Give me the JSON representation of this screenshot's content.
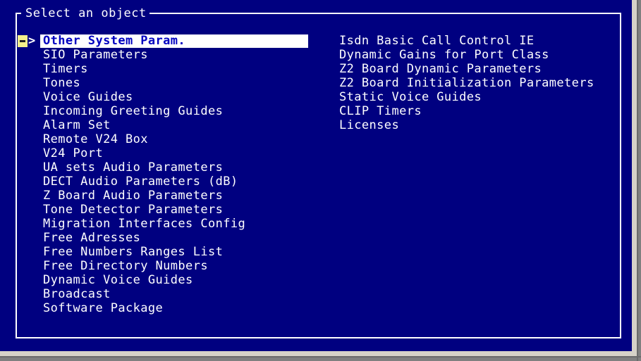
{
  "window": {
    "frame_title": "Select an object",
    "background_color": "#000080",
    "frame_color": "#ffffff",
    "text_color": "#ffffff",
    "highlight_bg_color": "#ffffff",
    "highlight_text_color": "#0000c0",
    "expander_color": "#f5f08c",
    "chrome_color": "#d6d2c8"
  },
  "selection": {
    "expander_glyph": "minus-box",
    "arrow_glyph": ">",
    "selected_index": 0
  },
  "left_column": [
    {
      "label": "Other System Param.",
      "selected": true
    },
    {
      "label": "SIO Parameters",
      "selected": false
    },
    {
      "label": "Timers",
      "selected": false
    },
    {
      "label": "Tones",
      "selected": false
    },
    {
      "label": "Voice Guides",
      "selected": false
    },
    {
      "label": "Incoming Greeting Guides",
      "selected": false
    },
    {
      "label": "Alarm Set",
      "selected": false
    },
    {
      "label": "Remote V24 Box",
      "selected": false
    },
    {
      "label": "V24 Port",
      "selected": false
    },
    {
      "label": "UA sets Audio Parameters",
      "selected": false
    },
    {
      "label": "DECT Audio Parameters (dB)",
      "selected": false
    },
    {
      "label": "Z Board Audio Parameters",
      "selected": false
    },
    {
      "label": "Tone Detector Parameters",
      "selected": false
    },
    {
      "label": "Migration Interfaces Config",
      "selected": false
    },
    {
      "label": "Free Adresses",
      "selected": false
    },
    {
      "label": "Free Numbers Ranges List",
      "selected": false
    },
    {
      "label": "Free Directory Numbers",
      "selected": false
    },
    {
      "label": "Dynamic Voice Guides",
      "selected": false
    },
    {
      "label": "Broadcast",
      "selected": false
    },
    {
      "label": "Software Package",
      "selected": false
    }
  ],
  "right_column": [
    {
      "label": "Isdn Basic Call Control IE",
      "selected": false
    },
    {
      "label": "Dynamic Gains for Port Class",
      "selected": false
    },
    {
      "label": "Z2 Board Dynamic Parameters",
      "selected": false
    },
    {
      "label": "Z2 Board Initialization Parameters",
      "selected": false
    },
    {
      "label": "Static Voice Guides",
      "selected": false
    },
    {
      "label": "CLIP Timers",
      "selected": false
    },
    {
      "label": "Licenses",
      "selected": false
    }
  ]
}
